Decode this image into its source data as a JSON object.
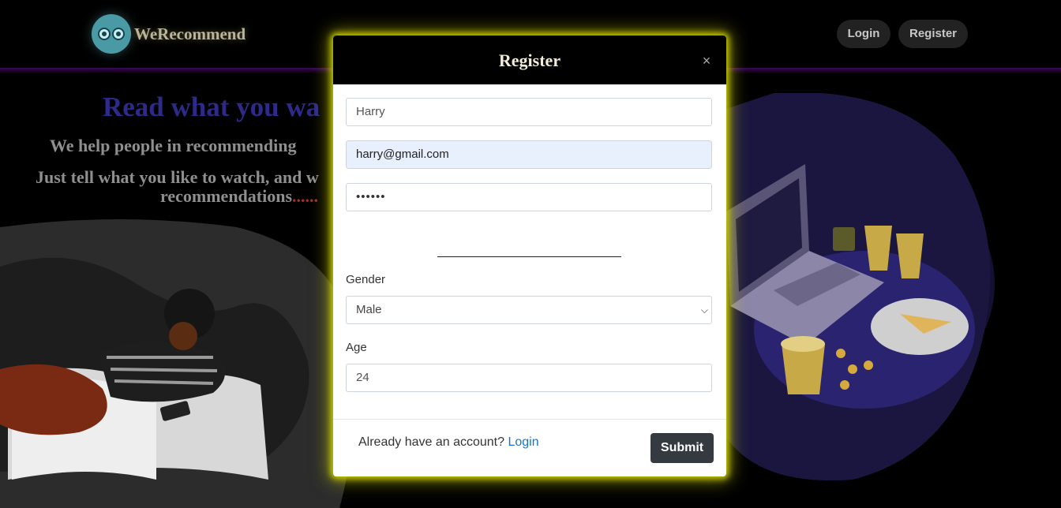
{
  "brand": {
    "name": "WeRecommend"
  },
  "nav": {
    "login_label": "Login",
    "register_label": "Register"
  },
  "hero": {
    "title": "Read what you wa",
    "subtitle": "We help people in recommending",
    "text_line1": "Just tell what you like to watch, and w",
    "text_line2": "recommendations",
    "text_dots": "......"
  },
  "modal": {
    "title": "Register",
    "close_glyph": "×",
    "name_value": "Harry",
    "email_value": "harry@gmail.com",
    "password_mask": "••••••",
    "gender_label": "Gender",
    "gender_selected": "Male",
    "age_label": "Age",
    "age_value": "24",
    "footer_text": "Already have an account?",
    "footer_link": "Login",
    "submit_label": "Submit"
  },
  "colors": {
    "modal_glow": "#c8cc00",
    "hero_title": "#2d2a8a",
    "link": "#1a73c8",
    "button_dark": "#343a40",
    "illustration_purple": "#2a2470"
  }
}
